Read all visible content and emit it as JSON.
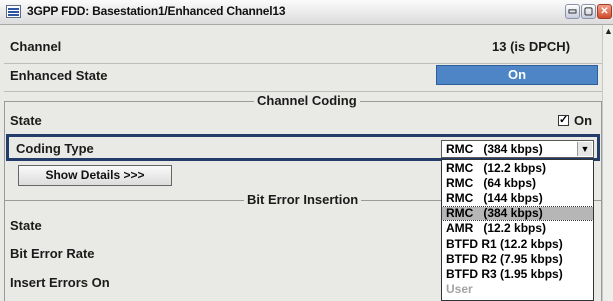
{
  "window": {
    "title": "3GPP FDD: Basestation1/Enhanced Channel13",
    "min_label": "▭",
    "max_label": "▢",
    "close_label": "✕"
  },
  "rows": {
    "channel_label": "Channel",
    "channel_value": "13 (is DPCH)",
    "enhanced_state_label": "Enhanced State",
    "enhanced_state_value": "On"
  },
  "channel_coding": {
    "title": "Channel Coding",
    "state_label": "State",
    "state_checked_mark": "✓",
    "state_value": "On",
    "coding_type_label": "Coding Type",
    "coding_type_selected": "RMC   (384 kbps)",
    "show_details_label": "Show Details >>>"
  },
  "coding_options": [
    {
      "label": "RMC   (12.2 kbps)",
      "selected": false,
      "disabled": false
    },
    {
      "label": "RMC   (64 kbps)",
      "selected": false,
      "disabled": false
    },
    {
      "label": "RMC   (144 kbps)",
      "selected": false,
      "disabled": false
    },
    {
      "label": "RMC   (384 kbps)",
      "selected": true,
      "disabled": false
    },
    {
      "label": "AMR   (12.2 kbps)",
      "selected": false,
      "disabled": false
    },
    {
      "label": "BTFD R1 (12.2 kbps)",
      "selected": false,
      "disabled": false
    },
    {
      "label": "BTFD R2 (7.95 kbps)",
      "selected": false,
      "disabled": false
    },
    {
      "label": "BTFD R3 (1.95 kbps)",
      "selected": false,
      "disabled": false
    },
    {
      "label": "User",
      "selected": false,
      "disabled": true
    }
  ],
  "bit_error_insertion": {
    "title": "Bit Error Insertion",
    "state_label": "State",
    "bit_error_rate_label": "Bit Error Rate",
    "insert_errors_on_label": "Insert Errors On"
  }
}
